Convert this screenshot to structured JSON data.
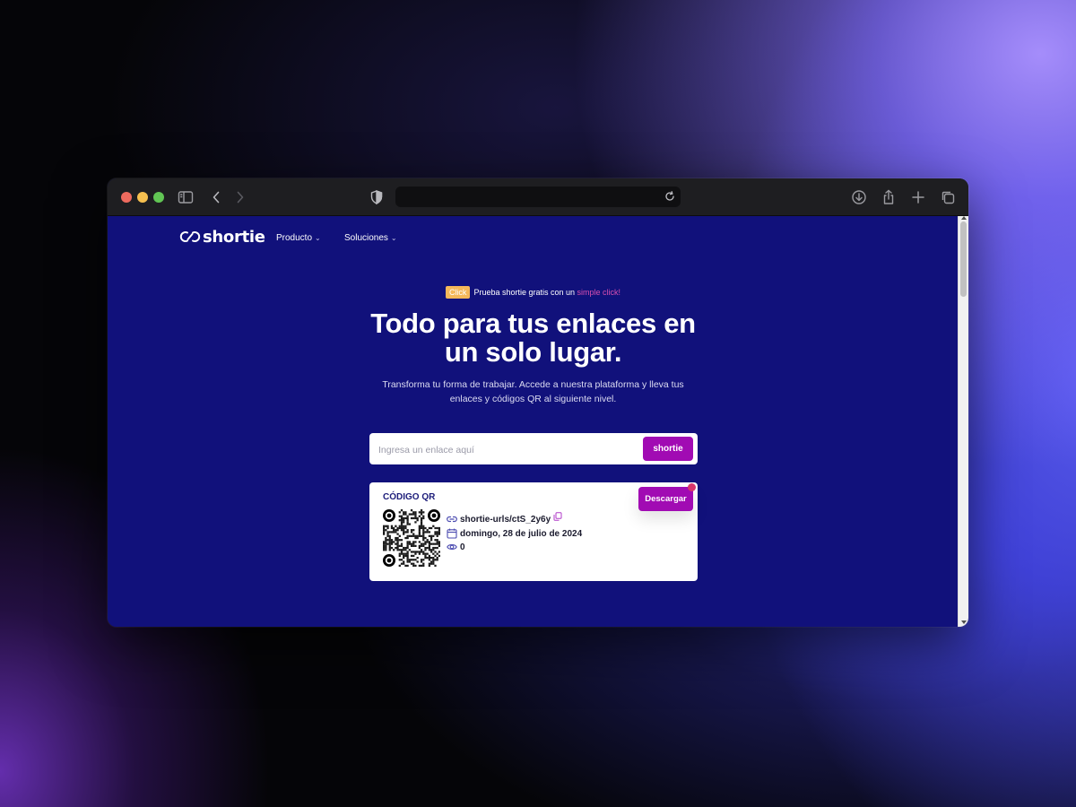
{
  "brand": {
    "name": "shortie",
    "icon": "link-icon"
  },
  "nav": [
    {
      "label": "Producto",
      "icon": "chevron-down-icon"
    },
    {
      "label": "Soluciones",
      "icon": "chevron-down-icon"
    }
  ],
  "promo": {
    "badge": "Click",
    "text": "Prueba shortie gratis con un",
    "accent": "simple click!"
  },
  "hero": {
    "title_line1": "Todo para tus enlaces en",
    "title_line2": "un solo lugar.",
    "subtitle": "Transforma tu forma de trabajar. Accede a nuestra plataforma y lleva tus enlaces y códigos QR al siguiente nivel."
  },
  "search": {
    "value": "",
    "placeholder": "Ingresa un enlace aquí",
    "button_label": "shortie"
  },
  "qr_card": {
    "title": "CÓDIGO QR",
    "download_label": "Descargar",
    "short_url": "shortie-urls/ctS_2y6y",
    "date": "domingo, 28 de julio de 2024",
    "views": "0"
  },
  "colors": {
    "page_bg": "#11117b",
    "accent_button": "#a10bb3",
    "badge": "#f5b85a",
    "promo_accent": "#d94fb0",
    "notification": "#d8366b",
    "card_title": "#1c1c7a"
  }
}
